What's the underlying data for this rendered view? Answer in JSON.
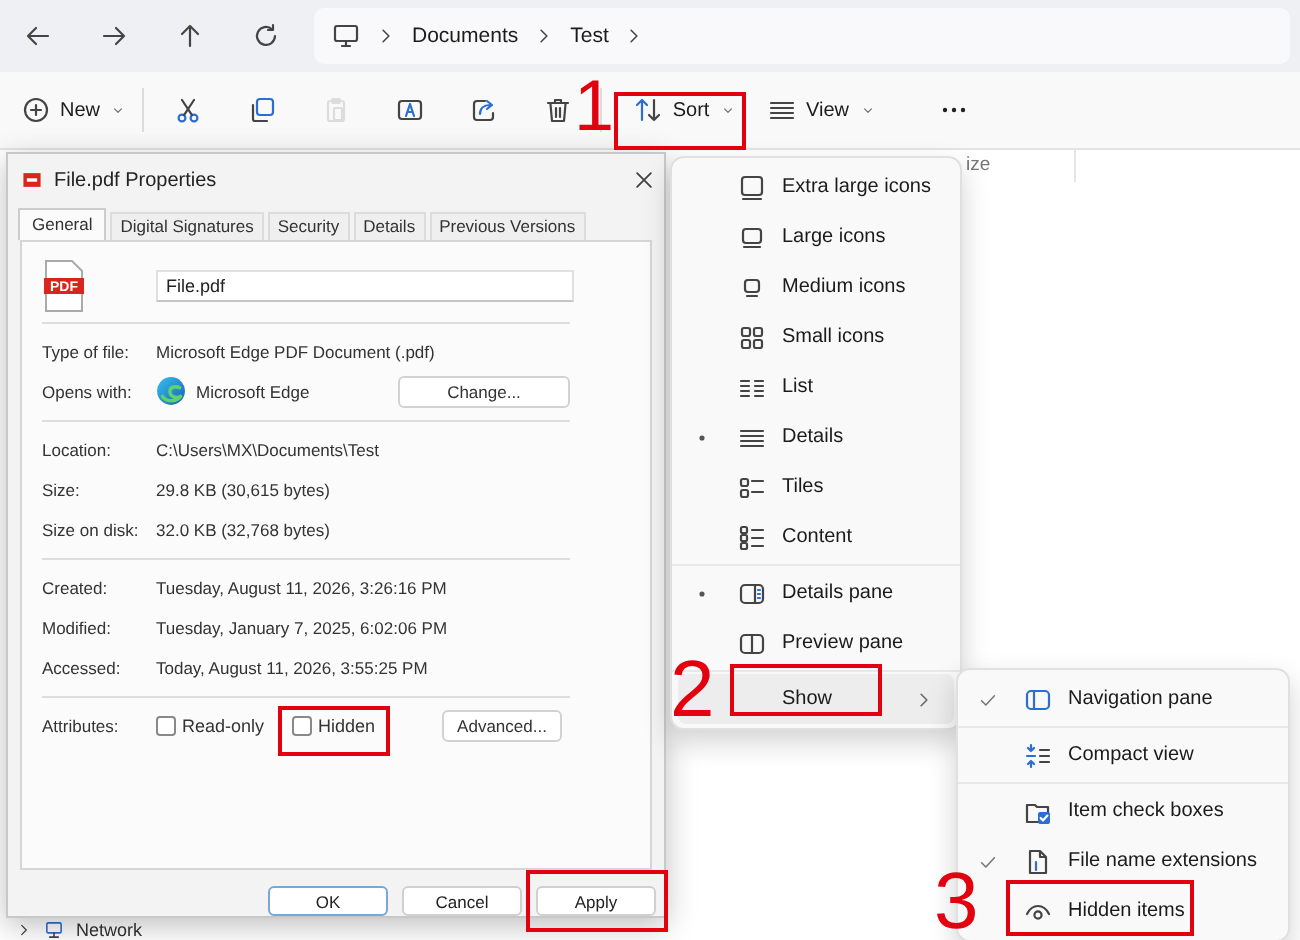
{
  "address_bar": {
    "crumbs": [
      "Documents",
      "Test"
    ]
  },
  "command_bar": {
    "commands": [
      {
        "kind": "new",
        "label": "New",
        "disabled": false
      },
      {
        "kind": "cut",
        "disabled": false
      },
      {
        "kind": "copy",
        "disabled": false
      },
      {
        "kind": "paste",
        "disabled": true
      },
      {
        "kind": "rename",
        "disabled": false
      },
      {
        "kind": "share",
        "disabled": false
      },
      {
        "kind": "delete",
        "disabled": false
      },
      {
        "kind": "sort",
        "label": "Sort",
        "disabled": false
      },
      {
        "kind": "view",
        "label": "View",
        "disabled": false
      },
      {
        "kind": "more",
        "disabled": false
      }
    ]
  },
  "file_list": {
    "column_header": "ize"
  },
  "navigation_pane": {
    "items": [
      "Network"
    ]
  },
  "properties_dialog": {
    "title": "File.pdf Properties",
    "tabs": [
      {
        "label": "General",
        "selected": true
      },
      {
        "label": "Digital Signatures",
        "selected": false
      },
      {
        "label": "Security",
        "selected": false
      },
      {
        "label": "Details",
        "selected": false
      },
      {
        "label": "Previous Versions",
        "selected": false
      }
    ],
    "file_icon_label": "PDF",
    "file_name": "File.pdf",
    "sections": [
      {
        "rows": [
          {
            "kind": "text",
            "label": "Type of file:",
            "value": "Microsoft Edge PDF Document (.pdf)"
          },
          {
            "kind": "app",
            "label": "Opens with:",
            "value": "Microsoft Edge",
            "button": "Change..."
          }
        ]
      },
      {
        "rows": [
          {
            "kind": "text",
            "label": "Location:",
            "value": "C:\\Users\\MX\\Documents\\Test"
          },
          {
            "kind": "text",
            "label": "Size:",
            "value": "29.8 KB (30,615 bytes)"
          },
          {
            "kind": "text",
            "label": "Size on disk:",
            "value": "32.0 KB (32,768 bytes)"
          }
        ]
      },
      {
        "rows": [
          {
            "kind": "text",
            "label": "Created:",
            "value": "Tuesday, August 11, 2026, 3:26:16 PM"
          },
          {
            "kind": "text",
            "label": "Modified:",
            "value": "Tuesday, January 7, 2025, 6:02:06 PM"
          },
          {
            "kind": "text",
            "label": "Accessed:",
            "value": "Today, August 11, 2026, 3:55:25 PM"
          }
        ]
      }
    ],
    "attributes": {
      "label": "Attributes:",
      "checkboxes": [
        {
          "label": "Read-only",
          "checked": false
        },
        {
          "label": "Hidden",
          "checked": false
        }
      ],
      "button": "Advanced..."
    },
    "buttons": [
      {
        "label": "OK",
        "default": true
      },
      {
        "label": "Cancel",
        "default": false
      },
      {
        "label": "Apply",
        "default": false
      }
    ]
  },
  "view_menu": {
    "groups": [
      {
        "items": [
          {
            "kind": "option",
            "label": "Extra large icons",
            "checked": false,
            "expanded": false
          },
          {
            "kind": "option",
            "label": "Large icons",
            "checked": false,
            "expanded": false
          },
          {
            "kind": "option",
            "label": "Medium icons",
            "checked": false,
            "expanded": false
          },
          {
            "kind": "option",
            "label": "Small icons",
            "checked": false,
            "expanded": false
          },
          {
            "kind": "option",
            "label": "List",
            "checked": false,
            "expanded": false
          },
          {
            "kind": "option",
            "label": "Details",
            "checked": true,
            "expanded": false
          },
          {
            "kind": "option",
            "label": "Tiles",
            "checked": false,
            "expanded": false
          },
          {
            "kind": "option",
            "label": "Content",
            "checked": false,
            "expanded": false
          }
        ]
      },
      {
        "items": [
          {
            "kind": "option",
            "label": "Details pane",
            "checked": true,
            "expanded": false
          },
          {
            "kind": "option",
            "label": "Preview pane",
            "checked": false,
            "expanded": false
          }
        ]
      },
      {
        "items": [
          {
            "kind": "submenu",
            "label": "Show",
            "checked": false,
            "expanded": true
          }
        ]
      }
    ]
  },
  "show_submenu": {
    "groups": [
      {
        "items": [
          {
            "kind": "option",
            "label": "Navigation pane",
            "checked": true,
            "expanded": false
          }
        ]
      },
      {
        "items": [
          {
            "kind": "option",
            "label": "Compact view",
            "checked": false,
            "expanded": false
          }
        ]
      },
      {
        "items": [
          {
            "kind": "option",
            "label": "Item check boxes",
            "checked": false,
            "expanded": false
          },
          {
            "kind": "option",
            "label": "File name extensions",
            "checked": true,
            "expanded": false
          },
          {
            "kind": "option",
            "label": "Hidden items",
            "checked": false,
            "expanded": false
          }
        ]
      }
    ]
  },
  "annotations": [
    {
      "kind": "step",
      "text": "1"
    },
    {
      "kind": "frame"
    },
    {
      "kind": "step",
      "text": "2"
    },
    {
      "kind": "frame"
    },
    {
      "kind": "step",
      "text": "3"
    },
    {
      "kind": "frame"
    },
    {
      "kind": "frame"
    },
    {
      "kind": "frame"
    }
  ]
}
